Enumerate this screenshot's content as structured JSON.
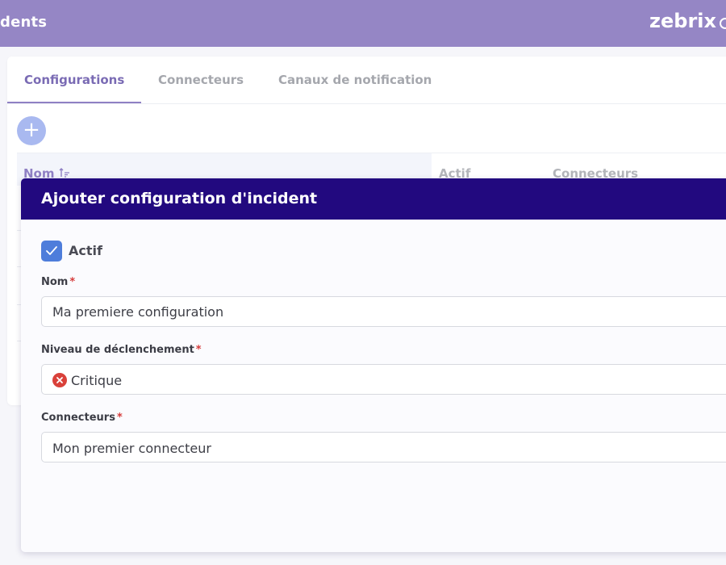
{
  "header": {
    "title": "dents",
    "brand": "zebrix"
  },
  "tabs": [
    {
      "label": "Configurations",
      "active": true
    },
    {
      "label": "Connecteurs",
      "active": false
    },
    {
      "label": "Canaux de notification",
      "active": false
    }
  ],
  "toolbar": {
    "add_label": "+"
  },
  "table": {
    "columns": [
      {
        "label": "Nom",
        "sort": "ascending"
      },
      {
        "label": "Actif"
      },
      {
        "label": "Connecteurs"
      }
    ]
  },
  "modal": {
    "title": "Ajouter configuration d'incident",
    "active_label": "Actif",
    "active_checked": true,
    "required_mark": "*",
    "name_label": "Nom",
    "name_value": "Ma premiere configuration",
    "level_label": "Niveau de déclenchement",
    "level_value": "Critique",
    "connectors_label": "Connecteurs",
    "connectors_value": "Mon premier connecteur"
  },
  "colors": {
    "header_bg": "#9586c5",
    "modal_header_bg": "#22097f",
    "accent": "#7a6bb4",
    "checkbox": "#4e7ddb",
    "critical": "#d9413a",
    "required": "#d63c3c"
  },
  "icons": {
    "sort": "sort-ascending-icon",
    "check": "check-icon",
    "critical": "close-circle-icon",
    "add": "plus-icon"
  }
}
